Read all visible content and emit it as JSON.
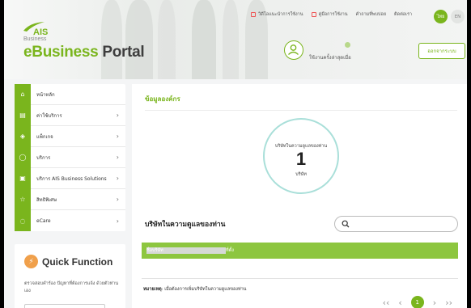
{
  "header": {
    "logo_text": "AIS",
    "logo_sub": "Business",
    "portal_e": "eBusiness",
    "portal_rest": "Portal",
    "top_links": [
      "วิดีโอแนะนำการใช้งาน",
      "คู่มือการใช้งาน",
      "คำถามที่พบบ่อย",
      "ติดต่อเรา"
    ],
    "lang_th": "ไทย",
    "lang_en": "EN",
    "user_label": "ใช้งานครั้งล่าสุดเมื่อ",
    "logout_label": "ออกจากระบบ"
  },
  "sidebar": {
    "items": [
      {
        "label": "หน้าหลัก",
        "icon": "home-icon",
        "chevron": ""
      },
      {
        "label": "ค่าใช้บริการ",
        "icon": "bill-icon",
        "chevron": "›"
      },
      {
        "label": "แพ็กเกจ",
        "icon": "package-icon",
        "chevron": "›"
      },
      {
        "label": "บริการ",
        "icon": "service-icon",
        "chevron": "›"
      },
      {
        "label": "บริการ AIS Business Solutions",
        "icon": "briefcase-icon",
        "chevron": "›"
      },
      {
        "label": "สิทธิพิเศษ",
        "icon": "star-icon",
        "chevron": "›"
      },
      {
        "label": "eCare",
        "icon": "ecare-icon",
        "chevron": "›"
      }
    ]
  },
  "quick": {
    "title": "Quick Function",
    "desc": "ตรวจสอบคำร้อง ปัญหาที่ต้องการแจ้ง ด้วยตัวท่านเอง"
  },
  "main": {
    "title": "ข้อมูลองค์กร",
    "circle_label": "บริษัทในความดูแลของท่าน",
    "circle_count": "1",
    "circle_unit": "บริษัท",
    "section_title": "บริษัทในความดูแลของท่าน",
    "search_placeholder": "",
    "table_headers": [
      "ชื่อบริษัท",
      "ที่ตั้ง"
    ],
    "note_bold": "หมายเหตุ",
    "note_text": ": เมื่อต้องการเพิ่มบริษัทในความดูแลของท่าน",
    "pager": {
      "first": "‹‹",
      "prev": "‹",
      "current": "1",
      "next": "›",
      "last": "››"
    }
  },
  "colors": {
    "brand_green": "#7ab51d",
    "table_header": "#8dc63f",
    "circle_border": "#a9dfd9"
  }
}
